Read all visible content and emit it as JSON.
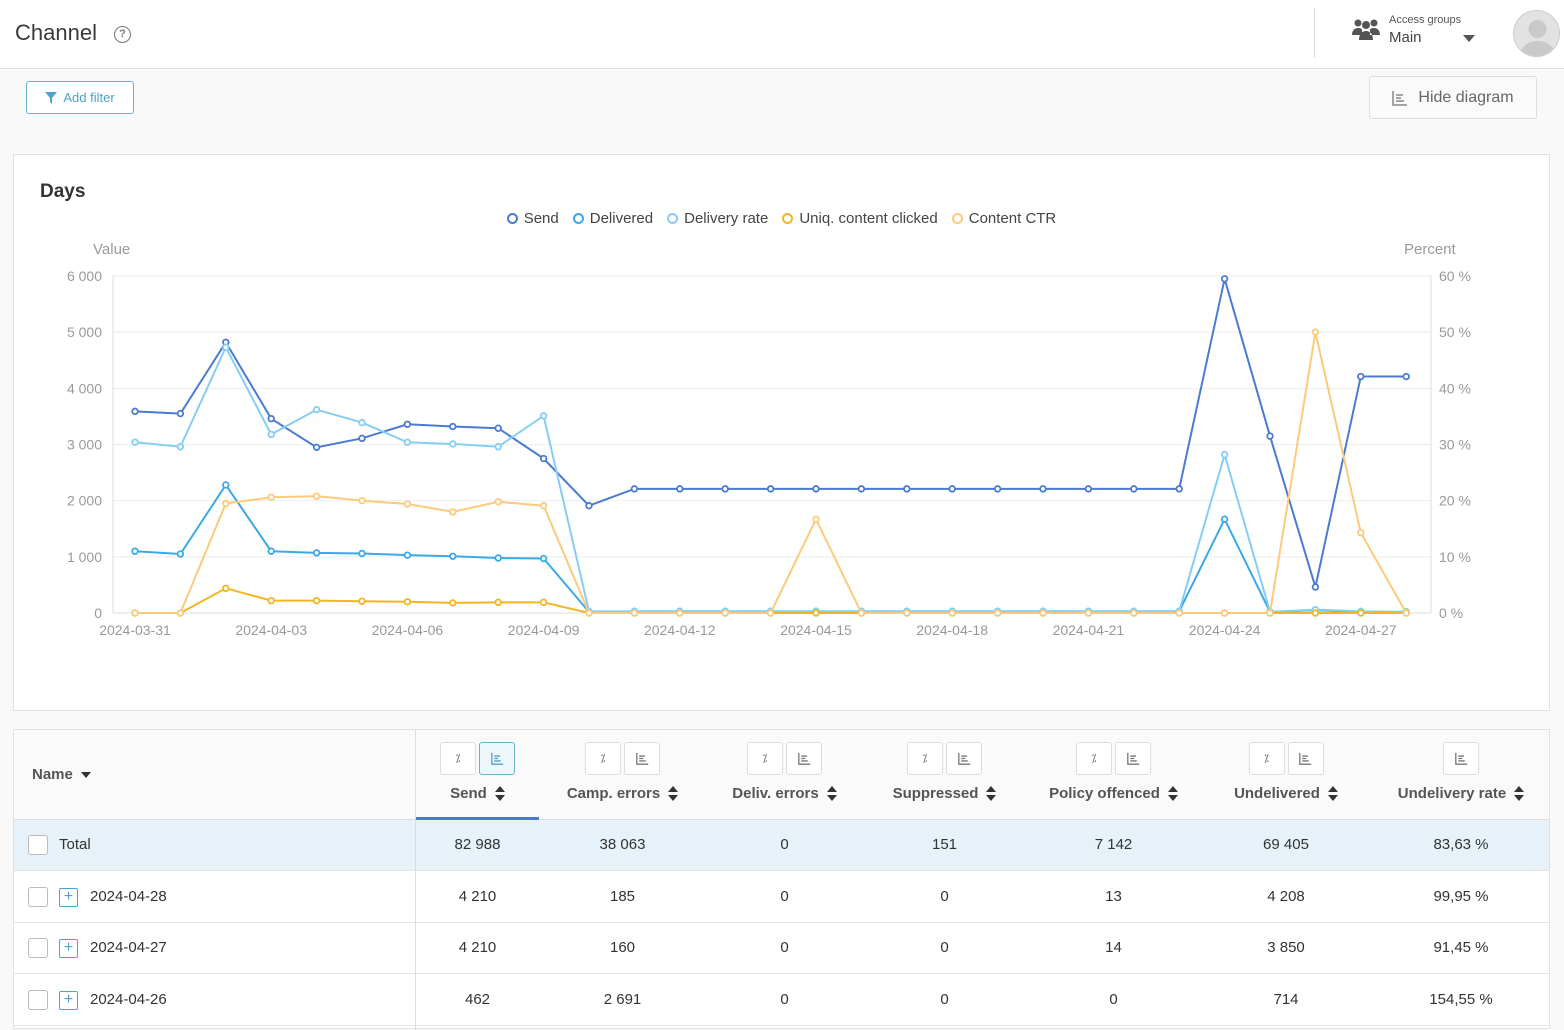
{
  "header": {
    "title": "Channel",
    "access_groups_label": "Access groups",
    "access_group_value": "Main"
  },
  "toolbar": {
    "add_filter": "Add filter",
    "hide_diagram": "Hide diagram"
  },
  "chart_data": {
    "type": "line",
    "title": "Days",
    "ylabel": "Value",
    "y2label": "Percent",
    "ylim": [
      0,
      6000
    ],
    "y2lim": [
      0,
      60
    ],
    "yticks": [
      "0",
      "1 000",
      "2 000",
      "3 000",
      "4 000",
      "5 000",
      "6 000"
    ],
    "y2ticks": [
      "0 %",
      "10 %",
      "20 %",
      "30 %",
      "40 %",
      "50 %",
      "60 %"
    ],
    "xtick_labels": [
      "2024-03-31",
      "2024-04-03",
      "2024-04-06",
      "2024-04-09",
      "2024-04-12",
      "2024-04-15",
      "2024-04-18",
      "2024-04-21",
      "2024-04-24",
      "2024-04-27"
    ],
    "x": [
      "2024-03-31",
      "2024-04-01",
      "2024-04-02",
      "2024-04-03",
      "2024-04-04",
      "2024-04-05",
      "2024-04-06",
      "2024-04-07",
      "2024-04-08",
      "2024-04-09",
      "2024-04-10",
      "2024-04-11",
      "2024-04-12",
      "2024-04-13",
      "2024-04-14",
      "2024-04-15",
      "2024-04-16",
      "2024-04-17",
      "2024-04-18",
      "2024-04-19",
      "2024-04-20",
      "2024-04-21",
      "2024-04-22",
      "2024-04-23",
      "2024-04-24",
      "2024-04-25",
      "2024-04-26",
      "2024-04-27",
      "2024-04-28"
    ],
    "grid": true,
    "legend_position": "top",
    "series": [
      {
        "name": "Send",
        "axis": "left",
        "color": "#4a7bd0",
        "values": [
          3590,
          3550,
          4820,
          3460,
          2950,
          3110,
          3360,
          3320,
          3290,
          2750,
          1910,
          2210,
          2210,
          2210,
          2210,
          2210,
          2210,
          2210,
          2210,
          2210,
          2210,
          2210,
          2210,
          2210,
          5950,
          3150,
          462,
          4210,
          4210
        ]
      },
      {
        "name": "Delivered",
        "axis": "left",
        "color": "#3aa9e8",
        "values": [
          1100,
          1050,
          2280,
          1100,
          1070,
          1060,
          1030,
          1010,
          980,
          970,
          20,
          30,
          30,
          30,
          30,
          30,
          30,
          30,
          30,
          30,
          30,
          30,
          30,
          30,
          1670,
          20,
          50,
          20,
          20
        ]
      },
      {
        "name": "Delivery rate",
        "axis": "right",
        "color": "#86cdf3",
        "values": [
          30.4,
          29.6,
          47.3,
          31.8,
          36.2,
          33.9,
          30.4,
          30.1,
          29.6,
          35.1,
          0.3,
          0.3,
          0.3,
          0.3,
          0.3,
          0.3,
          0.3,
          0.3,
          0.3,
          0.3,
          0.3,
          0.3,
          0.3,
          0.3,
          28.2,
          0.2,
          0.6,
          0.3,
          0.2
        ]
      },
      {
        "name": "Uniq. content clicked",
        "axis": "left",
        "color": "#f2b622",
        "values": [
          0,
          0,
          440,
          220,
          220,
          210,
          200,
          180,
          190,
          190,
          0,
          0,
          0,
          0,
          0,
          0,
          0,
          0,
          0,
          0,
          0,
          0,
          0,
          0,
          0,
          0,
          0,
          0,
          0
        ]
      },
      {
        "name": "Content CTR",
        "axis": "right",
        "color": "#fdc97a",
        "values": [
          0,
          0,
          19.5,
          20.6,
          20.8,
          20.0,
          19.4,
          18.0,
          19.8,
          19.1,
          0,
          0,
          0,
          0,
          0,
          16.7,
          0,
          0,
          0,
          0,
          0,
          0,
          0,
          0,
          0,
          0,
          50,
          14.3,
          0
        ]
      }
    ]
  },
  "table": {
    "name_header": "Name",
    "columns": [
      {
        "label": "Send",
        "active": true
      },
      {
        "label": "Camp. errors"
      },
      {
        "label": "Deliv. errors"
      },
      {
        "label": "Suppressed"
      },
      {
        "label": "Policy offenced"
      },
      {
        "label": "Undelivered"
      },
      {
        "label": "Undelivery rate",
        "chart_only": true
      }
    ],
    "percent_btn": "⁒",
    "rows": [
      {
        "name": "Total",
        "total": true,
        "values": [
          "82 988",
          "38 063",
          "0",
          "151",
          "7 142",
          "69 405",
          "83,63 %"
        ]
      },
      {
        "name": "2024-04-28",
        "values": [
          "4 210",
          "185",
          "0",
          "0",
          "13",
          "4 208",
          "99,95 %"
        ]
      },
      {
        "name": "2024-04-27",
        "values": [
          "4 210",
          "160",
          "0",
          "0",
          "14",
          "3 850",
          "91,45 %"
        ]
      },
      {
        "name": "2024-04-26",
        "values": [
          "462",
          "2 691",
          "0",
          "0",
          "0",
          "714",
          "154,55 %"
        ]
      }
    ]
  }
}
